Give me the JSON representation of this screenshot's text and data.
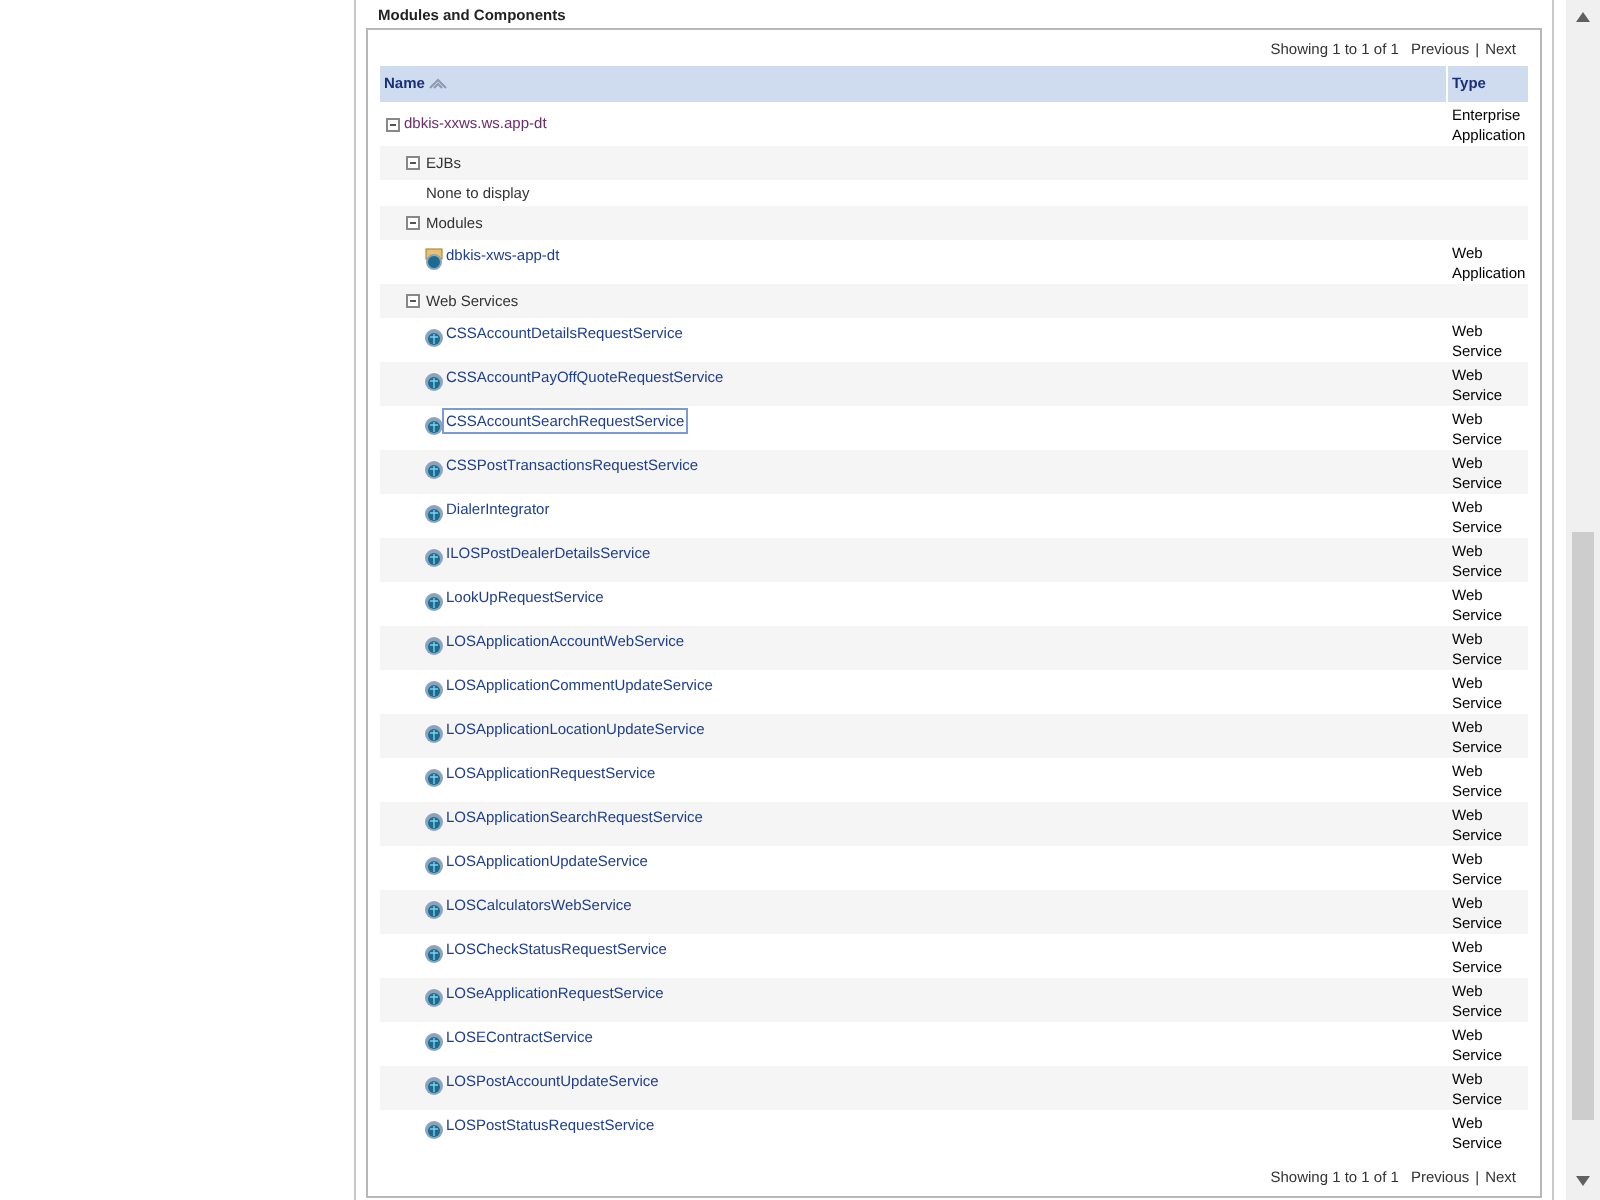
{
  "section_title": "Modules and Components",
  "pager_top": {
    "summary": "Showing 1 to 1 of 1",
    "previous": "Previous",
    "separator": "|",
    "next": "Next"
  },
  "columns": [
    {
      "label": "Name",
      "sortable": true
    },
    {
      "label": "Type"
    }
  ],
  "rows": [
    {
      "kind": "app",
      "name": "dbkis-xxws.ws.app-dt",
      "type": [
        "Enterprise",
        "Application"
      ],
      "expanded": true
    },
    {
      "kind": "group",
      "name": "EJBs",
      "expanded": true
    },
    {
      "kind": "empty",
      "name": "None to display"
    },
    {
      "kind": "group",
      "name": "Modules",
      "expanded": true
    },
    {
      "kind": "module",
      "name": "dbkis-xws-app-dt",
      "type": [
        "Web",
        "Application"
      ]
    },
    {
      "kind": "group",
      "name": "Web Services",
      "expanded": true
    },
    {
      "kind": "service",
      "name": "CSSAccountDetailsRequestService",
      "type": [
        "Web",
        "Service"
      ],
      "focused": false
    },
    {
      "kind": "service",
      "name": "CSSAccountPayOffQuoteRequestService",
      "type": [
        "Web",
        "Service"
      ],
      "focused": false
    },
    {
      "kind": "service",
      "name": "CSSAccountSearchRequestService",
      "type": [
        "Web",
        "Service"
      ],
      "focused": true
    },
    {
      "kind": "service",
      "name": "CSSPostTransactionsRequestService",
      "type": [
        "Web",
        "Service"
      ],
      "focused": false
    },
    {
      "kind": "service",
      "name": "DialerIntegrator",
      "type": [
        "Web",
        "Service"
      ],
      "focused": false
    },
    {
      "kind": "service",
      "name": "ILOSPostDealerDetailsService",
      "type": [
        "Web",
        "Service"
      ],
      "focused": false
    },
    {
      "kind": "service",
      "name": "LookUpRequestService",
      "type": [
        "Web",
        "Service"
      ],
      "focused": false
    },
    {
      "kind": "service",
      "name": "LOSApplicationAccountWebService",
      "type": [
        "Web",
        "Service"
      ],
      "focused": false
    },
    {
      "kind": "service",
      "name": "LOSApplicationCommentUpdateService",
      "type": [
        "Web",
        "Service"
      ],
      "focused": false
    },
    {
      "kind": "service",
      "name": "LOSApplicationLocationUpdateService",
      "type": [
        "Web",
        "Service"
      ],
      "focused": false
    },
    {
      "kind": "service",
      "name": "LOSApplicationRequestService",
      "type": [
        "Web",
        "Service"
      ],
      "focused": false
    },
    {
      "kind": "service",
      "name": "LOSApplicationSearchRequestService",
      "type": [
        "Web",
        "Service"
      ],
      "focused": false
    },
    {
      "kind": "service",
      "name": "LOSApplicationUpdateService",
      "type": [
        "Web",
        "Service"
      ],
      "focused": false
    },
    {
      "kind": "service",
      "name": "LOSCalculatorsWebService",
      "type": [
        "Web",
        "Service"
      ],
      "focused": false
    },
    {
      "kind": "service",
      "name": "LOSCheckStatusRequestService",
      "type": [
        "Web",
        "Service"
      ],
      "focused": false
    },
    {
      "kind": "service",
      "name": "LOSeApplicationRequestService",
      "type": [
        "Web",
        "Service"
      ],
      "focused": false
    },
    {
      "kind": "service",
      "name": "LOSEContractService",
      "type": [
        "Web",
        "Service"
      ],
      "focused": false
    },
    {
      "kind": "service",
      "name": "LOSPostAccountUpdateService",
      "type": [
        "Web",
        "Service"
      ],
      "focused": false
    },
    {
      "kind": "service",
      "name": "LOSPostStatusRequestService",
      "type": [
        "Web",
        "Service"
      ],
      "focused": false
    }
  ],
  "pager_bottom": {
    "summary": "Showing 1 to 1 of 1",
    "previous": "Previous",
    "separator": "|",
    "next": "Next"
  }
}
